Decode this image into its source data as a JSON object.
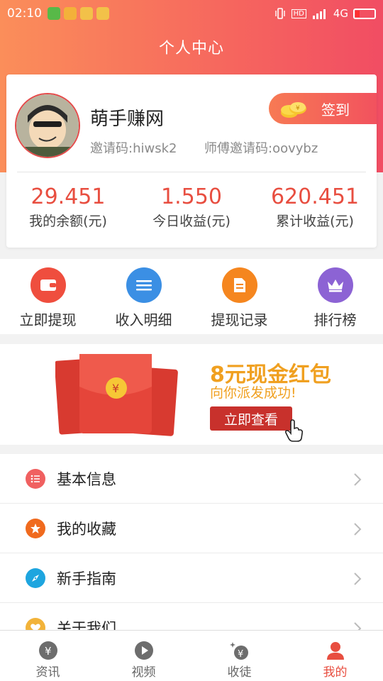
{
  "status_bar": {
    "time": "02:10",
    "network": "4G",
    "hd": "HD"
  },
  "header": {
    "title": "个人中心"
  },
  "profile": {
    "name": "萌手赚网",
    "invite_code": "邀请码:hiwsk2",
    "master_invite_code": "师傅邀请码:oovybz",
    "signin_label": "签到"
  },
  "stats": [
    {
      "value": "29.451",
      "label": "我的余额(元)"
    },
    {
      "value": "1.550",
      "label": "今日收益(元)"
    },
    {
      "value": "620.451",
      "label": "累计收益(元)"
    }
  ],
  "actions": [
    {
      "label": "立即提现",
      "icon": "wallet-icon",
      "color": "#ef4e3e"
    },
    {
      "label": "收入明细",
      "icon": "list-icon",
      "color": "#3b8fe4"
    },
    {
      "label": "提现记录",
      "icon": "document-icon",
      "color": "#f5861f"
    },
    {
      "label": "排行榜",
      "icon": "crown-icon",
      "color": "#8c63d4"
    }
  ],
  "banner": {
    "title": "8元现金红包",
    "subtitle": "向你派发成功!",
    "button": "立即查看",
    "coin_symbol": "¥"
  },
  "menu": [
    {
      "label": "基本信息",
      "icon": "info-list-icon",
      "color": "#f06060"
    },
    {
      "label": "我的收藏",
      "icon": "star-icon",
      "color": "#f06a1e"
    },
    {
      "label": "新手指南",
      "icon": "compass-icon",
      "color": "#1ea5df"
    },
    {
      "label": "关于我们",
      "icon": "heart-icon",
      "color": "#f2b33a"
    }
  ],
  "tabbar": [
    {
      "label": "资讯",
      "icon": "yuan-coin-icon",
      "active": false
    },
    {
      "label": "视频",
      "icon": "play-icon",
      "active": false
    },
    {
      "label": "收徒",
      "icon": "apprentice-icon",
      "active": false
    },
    {
      "label": "我的",
      "icon": "user-icon",
      "active": true
    }
  ],
  "colors": {
    "accent": "#e84e40",
    "header_start": "#fb8e5a",
    "header_end": "#f14d63"
  }
}
